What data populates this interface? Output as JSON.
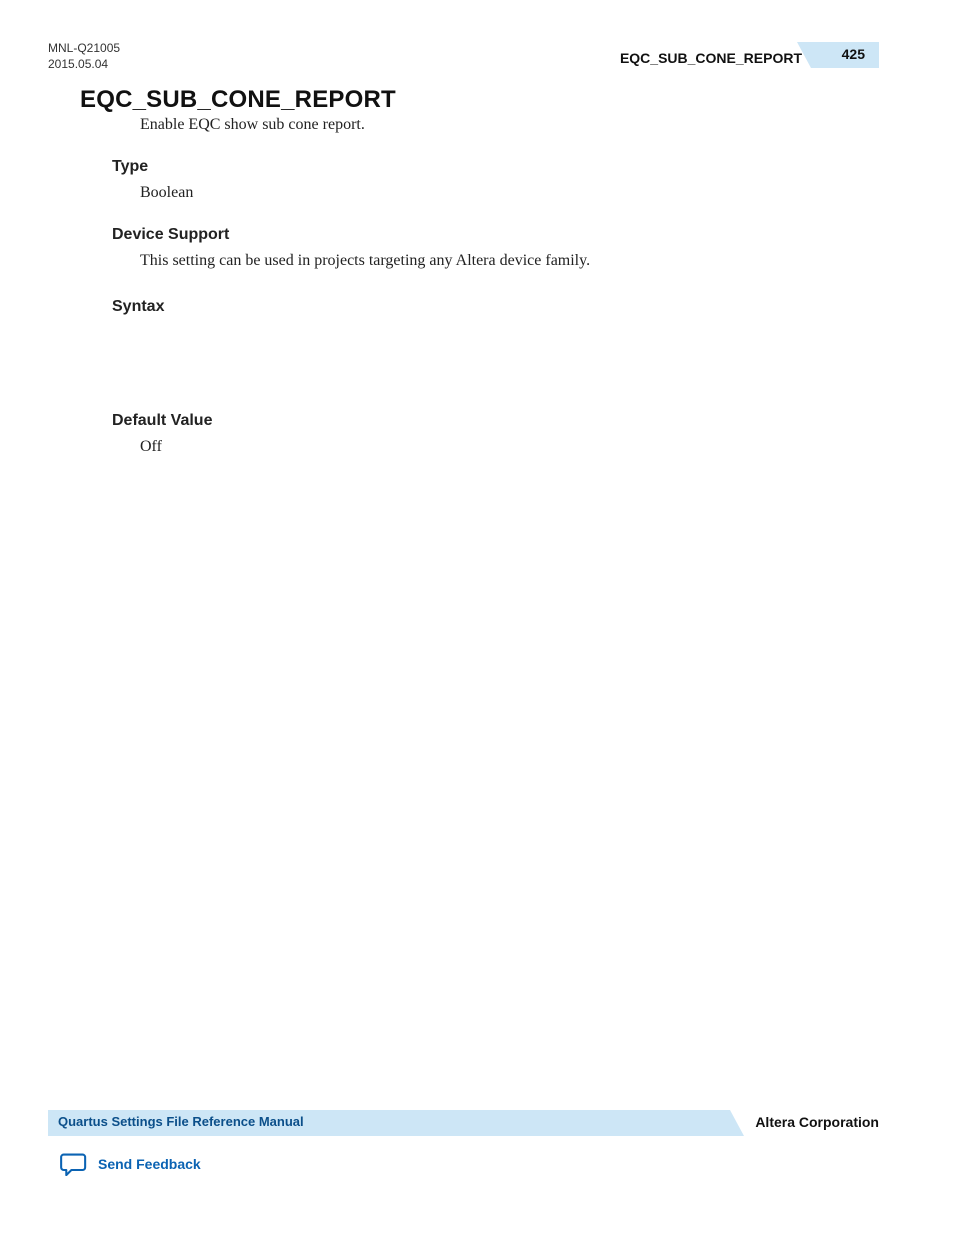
{
  "header": {
    "doc_id": "MNL-Q21005",
    "date": "2015.05.04",
    "running_title": "EQC_SUB_CONE_REPORT",
    "page_number": "425"
  },
  "main": {
    "title": "EQC_SUB_CONE_REPORT",
    "description": "Enable EQC show sub cone report.",
    "sections": {
      "type": {
        "heading": "Type",
        "value": "Boolean"
      },
      "device_support": {
        "heading": "Device Support",
        "value": "This setting can be used in projects targeting any Altera device family."
      },
      "syntax": {
        "heading": "Syntax"
      },
      "default_value": {
        "heading": "Default Value",
        "value": "Off"
      }
    }
  },
  "footer": {
    "manual_title": "Quartus Settings File Reference Manual",
    "corporation": "Altera Corporation",
    "feedback_label": "Send Feedback"
  },
  "colors": {
    "ribbon": "#cde6f6",
    "link": "#0b63b3"
  }
}
